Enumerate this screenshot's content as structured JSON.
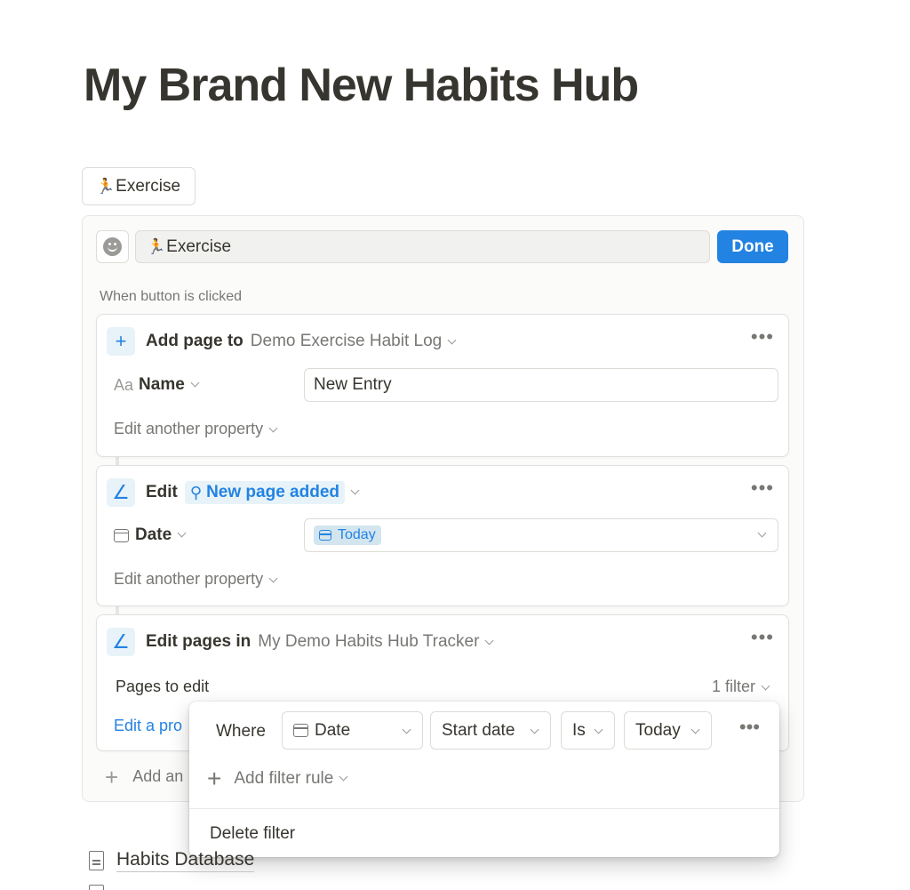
{
  "page": {
    "title": "My Brand New Habits Hub"
  },
  "button_block": {
    "emoji": "🏃",
    "label": "Exercise"
  },
  "editor": {
    "name_emoji": "🏃",
    "name_value": "Exercise",
    "done_label": "Done",
    "trigger_label": "When button is clicked"
  },
  "steps": [
    {
      "icon": "plus-icon",
      "action": "Add page to",
      "target": "Demo Exercise Habit Log",
      "property": {
        "icon": "Aa",
        "name": "Name",
        "value": "New Entry"
      },
      "edit_another": "Edit another property"
    },
    {
      "icon": "pencil-icon",
      "action": "Edit",
      "target": "New page added",
      "property": {
        "icon": "calendar-icon",
        "name": "Date",
        "value": "Today"
      },
      "edit_another": "Edit another property"
    },
    {
      "icon": "pencil-icon",
      "action": "Edit pages in",
      "target": "My Demo Habits Hub Tracker",
      "pages_to_edit": "Pages to edit",
      "filter_count": "1 filter",
      "edit_link": "Edit a pro"
    }
  ],
  "add_action": "Add an",
  "filter_popover": {
    "where": "Where",
    "property": "Date",
    "date_part": "Start date",
    "operator": "Is",
    "value": "Today",
    "add_rule": "Add filter rule",
    "delete": "Delete filter"
  },
  "links": [
    {
      "icon": "document-icon",
      "label": "Habits Database"
    }
  ],
  "colors": {
    "accent": "#2383e2",
    "text": "#37352f",
    "muted": "#787774",
    "chip_bg": "#e7f3f8"
  }
}
